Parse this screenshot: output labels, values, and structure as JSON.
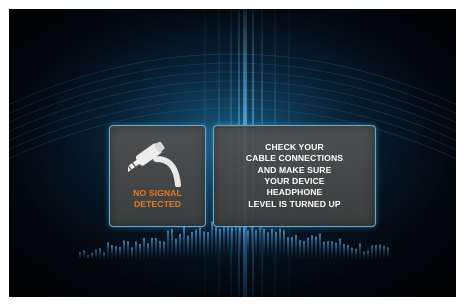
{
  "no_signal_panel": {
    "icon": "headphone-plug-icon",
    "status_lines": [
      "NO SIGNAL",
      "DETECTED"
    ],
    "status_color": "#e47c20"
  },
  "message_panel": {
    "lines": [
      "CHECK YOUR",
      "CABLE CONNECTIONS",
      "AND MAKE SURE",
      "YOUR DEVICE",
      "HEADPHONE",
      "LEVEL IS TURNED UP"
    ]
  },
  "colors": {
    "background": "#02070d",
    "glow": "#3fa7e6",
    "panel_border": "#5fb0cf",
    "panel_fill": "#4a4a4a"
  }
}
